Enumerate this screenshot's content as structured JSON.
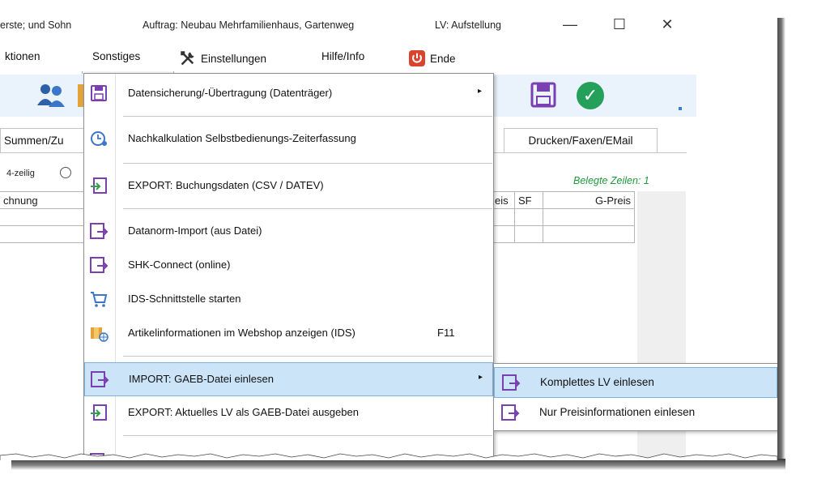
{
  "window": {
    "title_left": "erste; und Sohn",
    "title_mid": "Auftrag: Neubau Mehrfamilienhaus, Gartenweg",
    "title_right": "LV: Aufstellung",
    "btn_min": "—",
    "btn_max": "☐",
    "btn_close": "✕"
  },
  "menubar": {
    "aktionen": "ktionen",
    "sonstiges": "Sonstiges",
    "einstellungen": "Einstellungen",
    "hilfe": "Hilfe/Info",
    "ende": "Ende"
  },
  "tabs": {
    "summen": "Summen/Zu",
    "drucken": "Drucken/Faxen/EMail"
  },
  "content": {
    "radio_label": "4-zeilig",
    "belegte": "Belegte Zeilen: 1",
    "col_rechnung": "chnung",
    "col_preis": "eis",
    "col_sf": "SF",
    "col_gpreis": "G-Preis"
  },
  "dropdown": {
    "items": [
      {
        "label": "Datensicherung/-Übertragung  (Datenträger)",
        "icon": "floppy-icon",
        "submenu": true
      },
      {
        "label": "Nachkalkulation Selbstbedienungs-Zeiterfassung",
        "icon": "clock-user-icon"
      },
      {
        "label": "EXPORT: Buchungsdaten (CSV / DATEV)",
        "icon": "export-icon"
      },
      {
        "label": "Datanorm-Import (aus Datei)",
        "icon": "import-icon"
      },
      {
        "label": "SHK-Connect (online)",
        "icon": "import-icon"
      },
      {
        "label": "IDS-Schnittstelle starten",
        "icon": "cart-icon"
      },
      {
        "label": "Artikelinformationen im Webshop anzeigen (IDS)",
        "shortcut": "F11",
        "icon": "box-globe-icon"
      },
      {
        "label": "IMPORT: GAEB-Datei einlesen",
        "icon": "import-icon",
        "submenu": true,
        "highlighted": true
      },
      {
        "label": "EXPORT: Aktuelles LV als GAEB-Datei ausgeben",
        "icon": "export-icon"
      }
    ],
    "arrow": "▸"
  },
  "submenu": {
    "items": [
      {
        "label": "Komplettes LV einlesen",
        "highlighted": true
      },
      {
        "label": "Nur Preisinformationen einlesen"
      }
    ]
  },
  "colors": {
    "highlight": "#cce4f7",
    "highlight_border": "#7ab2e0",
    "toolbar_bg": "#eaf3fb",
    "accent_green": "#1f9a3a",
    "icon_purple": "#7a3fb2"
  }
}
